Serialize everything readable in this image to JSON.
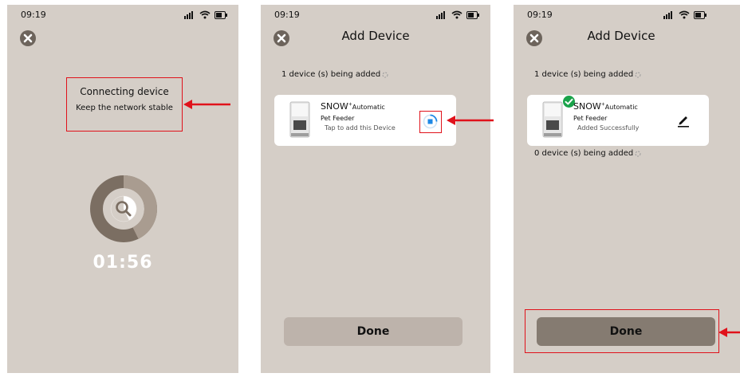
{
  "colors": {
    "screen_bg": "#d5cec7",
    "annotation": "#e0121b",
    "done_inactive": "#bdb3ab",
    "done_active": "#857b71",
    "success": "#1aa34a",
    "accent_blue": "#1e88e5"
  },
  "step1": {
    "time": "09:19",
    "status_icons": [
      "signal-icon",
      "wifi-icon",
      "battery-icon"
    ],
    "connect_title": "Connecting device",
    "connect_subtitle": "Keep the network stable",
    "timer": "01:56"
  },
  "step2": {
    "time": "09:19",
    "title": "Add Device",
    "adding_count": "1 device (s) being added",
    "product_brand": "SNOW",
    "product_sup": "+",
    "product_model": "Automatic",
    "product_type": "Pet Feeder",
    "product_hint": "Tap to add this Device",
    "done_label": "Done"
  },
  "step3": {
    "time": "09:19",
    "title": "Add Device",
    "adding_count": "1 device (s) being added",
    "product_brand": "SNOW",
    "product_sup": "+",
    "product_model": "Automatic",
    "product_type": "Pet Feeder",
    "product_status": "Added  Successfully",
    "remaining_count": "0 device (s) being added",
    "done_label": "Done"
  }
}
